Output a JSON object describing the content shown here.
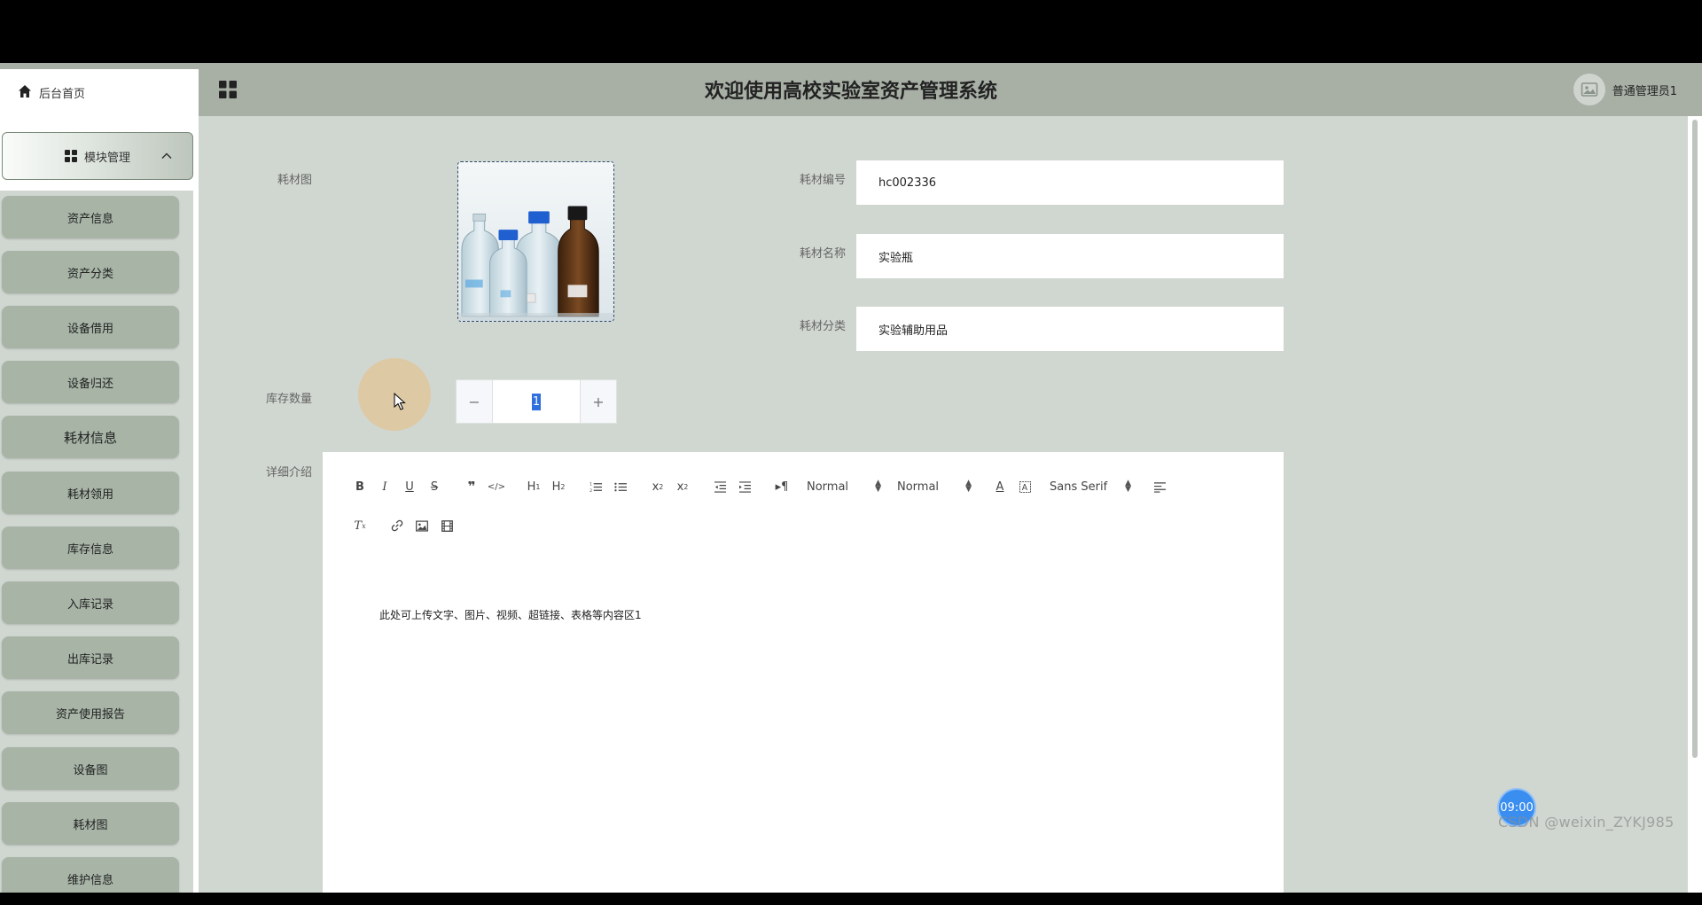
{
  "header": {
    "home_label": "后台首页",
    "title": "欢迎使用高校实验室资产管理系统",
    "user_name": "普通管理员1"
  },
  "sidebar": {
    "parent_label": "模块管理",
    "items": [
      {
        "label": "资产信息"
      },
      {
        "label": "资产分类"
      },
      {
        "label": "设备借用"
      },
      {
        "label": "设备归还"
      },
      {
        "label": "耗材信息"
      },
      {
        "label": "耗材领用"
      },
      {
        "label": "库存信息"
      },
      {
        "label": "入库记录"
      },
      {
        "label": "出库记录"
      },
      {
        "label": "资产使用报告"
      },
      {
        "label": "设备图"
      },
      {
        "label": "耗材图"
      },
      {
        "label": "维护信息"
      }
    ]
  },
  "form": {
    "image_label": "耗材图",
    "code_label": "耗材编号",
    "code_value": "hc002336",
    "name_label": "耗材名称",
    "name_value": "实验瓶",
    "category_label": "耗材分类",
    "category_value": "实验辅助用品",
    "stock_label": "库存数量",
    "stock_value": "1",
    "stepper_minus": "−",
    "stepper_plus": "+",
    "detail_label": "详细介绍"
  },
  "editor": {
    "size_select": "Normal",
    "header_select": "Normal",
    "font_select": "Sans Serif",
    "content": "此处可上传文字、图片、视频、超链接、表格等内容区1"
  },
  "overlay": {
    "clock": "09:00",
    "watermark": "CSDN @weixin_ZYKJ985"
  }
}
